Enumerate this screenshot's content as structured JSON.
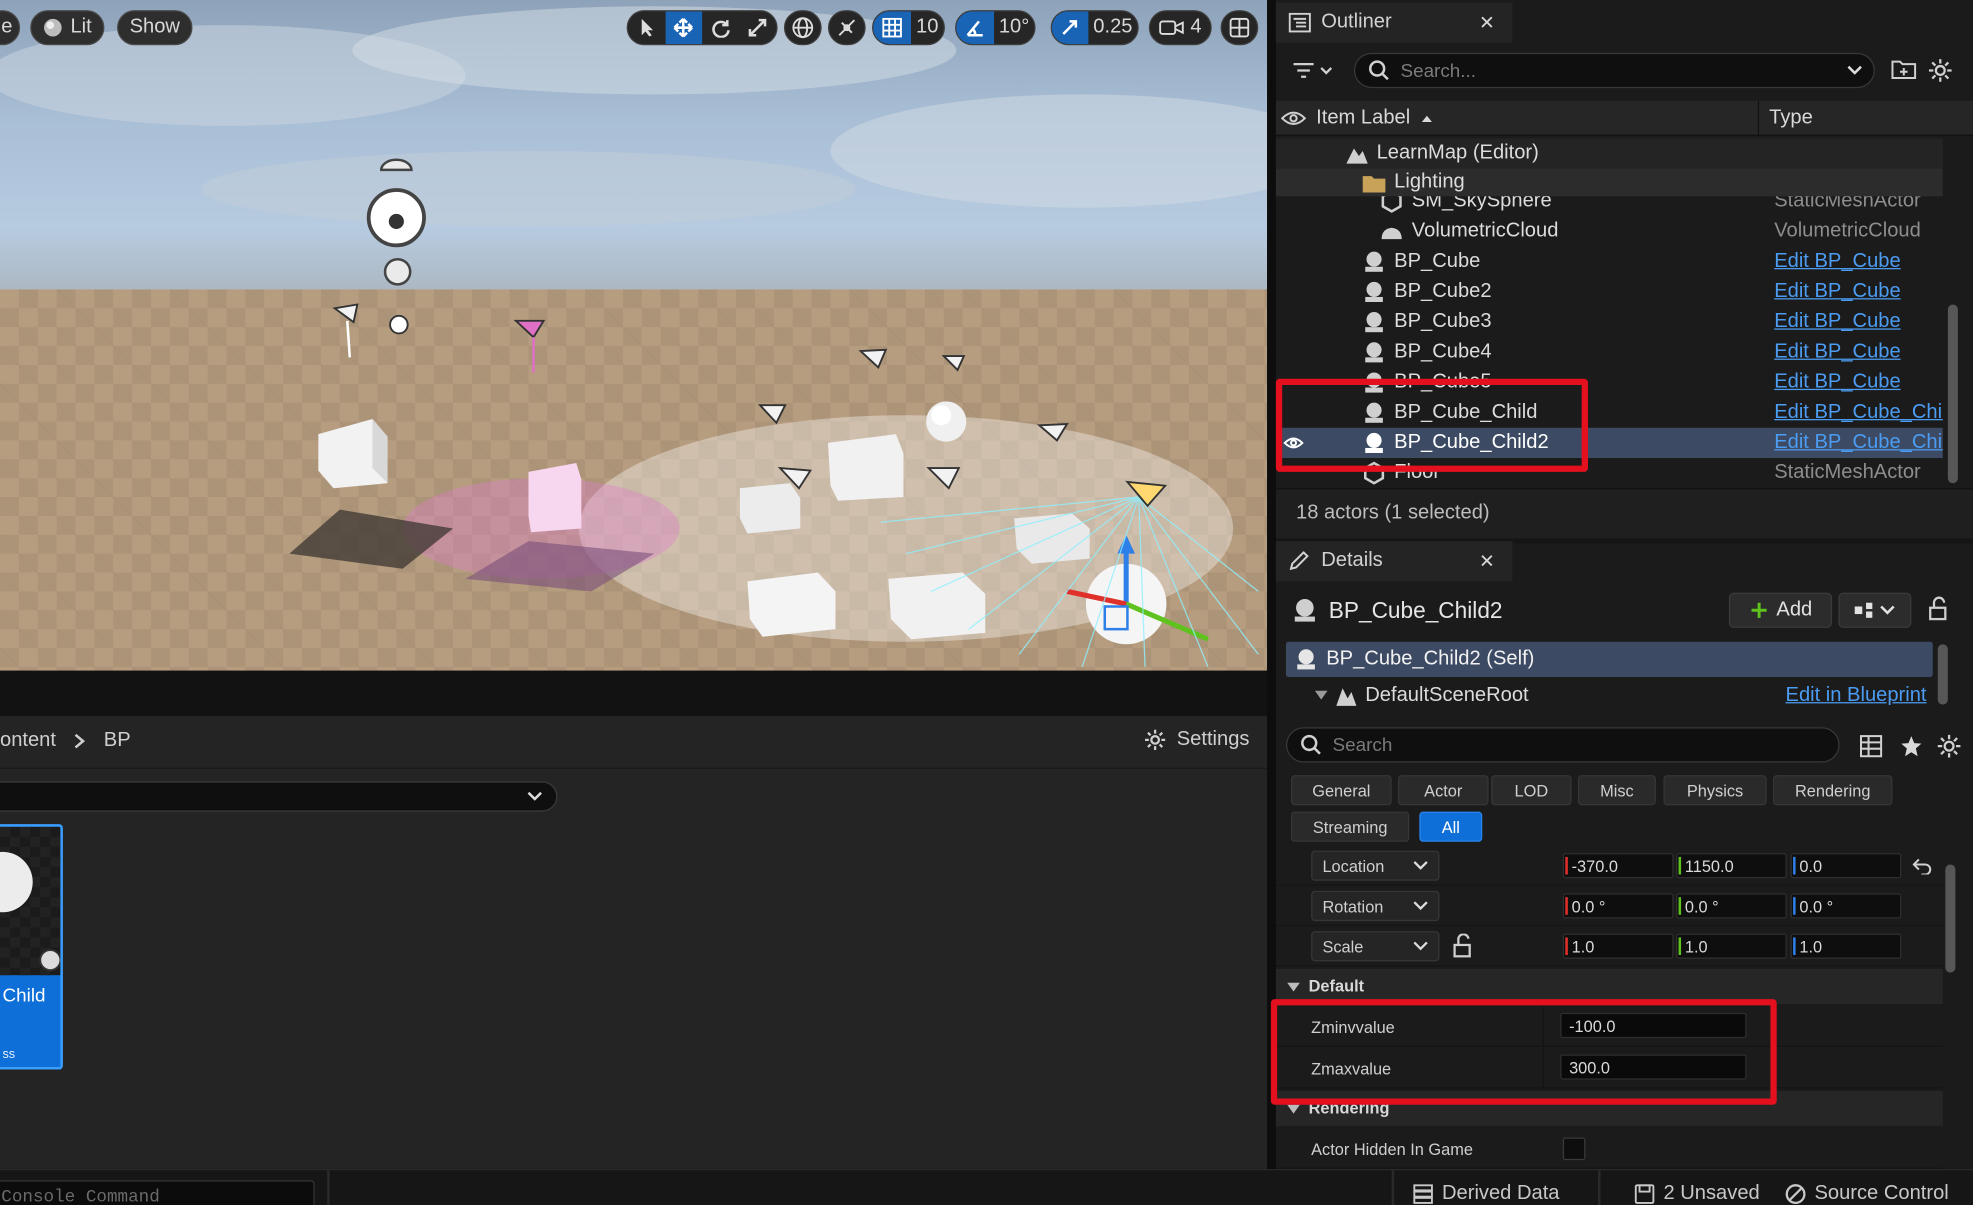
{
  "viewport": {
    "menu_partial": "e",
    "lit_label": "Lit",
    "show_label": "Show",
    "grid_snap": "10",
    "angle_snap": "10°",
    "scale_snap": "0.25",
    "camera_speed": "4"
  },
  "content_browser": {
    "breadcrumb_1": "ontent",
    "breadcrumb_2": "BP",
    "settings_label": "Settings",
    "tile_name": "Child",
    "tile_sub": "ss"
  },
  "statusbar": {
    "console_placeholder": "Console Command",
    "derived_data": "Derived Data",
    "unsaved": "2 Unsaved",
    "source_control": "Source Control"
  },
  "outliner": {
    "title": "Outliner",
    "search_placeholder": "Search...",
    "col_label": "Item Label",
    "col_type": "Type",
    "map_row": "LearnMap (Editor)",
    "folder_row": "Lighting",
    "rows": [
      {
        "label": "SM_SkySphere",
        "type": "StaticMeshActor"
      },
      {
        "label": "VolumetricCloud",
        "type": "VolumetricCloud"
      },
      {
        "label": "BP_Cube",
        "type": "Edit BP_Cube"
      },
      {
        "label": "BP_Cube2",
        "type": "Edit BP_Cube"
      },
      {
        "label": "BP_Cube3",
        "type": "Edit BP_Cube"
      },
      {
        "label": "BP_Cube4",
        "type": "Edit BP_Cube"
      },
      {
        "label": "BP_Cube5",
        "type": "Edit BP_Cube"
      },
      {
        "label": "BP_Cube_Child",
        "type": "Edit BP_Cube_Chil"
      },
      {
        "label": "BP_Cube_Child2",
        "type": "Edit BP_Cube_Chil"
      },
      {
        "label": "Floor",
        "type": "StaticMeshActor"
      }
    ],
    "footer": "18 actors (1 selected)"
  },
  "details": {
    "title": "Details",
    "actor_name": "BP_Cube_Child2",
    "add_label": "Add",
    "self_row": "BP_Cube_Child2 (Self)",
    "root_row": "DefaultSceneRoot",
    "edit_blueprint": "Edit in Blueprint",
    "search_placeholder": "Search",
    "filters": [
      "General",
      "Actor",
      "LOD",
      "Misc",
      "Physics",
      "Rendering",
      "Streaming",
      "All"
    ],
    "active_filter": "All",
    "location_label": "Location",
    "rotation_label": "Rotation",
    "scale_label": "Scale",
    "location": [
      "-370.0",
      "1150.0",
      "0.0"
    ],
    "rotation": [
      "0.0 °",
      "0.0 °",
      "0.0 °"
    ],
    "scale": [
      "1.0",
      "1.0",
      "1.0"
    ],
    "section_default": "Default",
    "zmin_label": "Zminvvalue",
    "zmin_value": "-100.0",
    "zmax_label": "Zmaxvalue",
    "zmax_value": "300.0",
    "section_rendering": "Rendering",
    "hidden_label": "Actor Hidden In Game"
  },
  "colors": {
    "accent_blue": "#0e6fd8",
    "link_blue": "#4b9cf2",
    "highlight_red": "#e4101e",
    "axis_x": "#e0302a",
    "axis_y": "#5fc21e",
    "axis_z": "#2f7fe8"
  }
}
